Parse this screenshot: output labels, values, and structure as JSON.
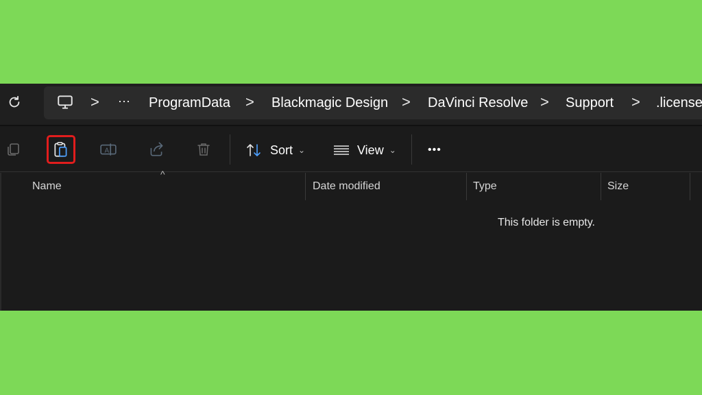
{
  "breadcrumb": {
    "overflow_label": "···",
    "items": [
      "ProgramData",
      "Blackmagic Design",
      "DaVinci Resolve",
      "Support",
      ".license"
    ],
    "separator": ">"
  },
  "toolbar": {
    "sort_label": "Sort",
    "view_label": "View",
    "more_label": "•••",
    "icons": [
      "copy-icon",
      "paste-icon",
      "rename-icon",
      "share-icon",
      "delete-icon"
    ],
    "selected_icon": "paste-icon",
    "highlight_color": "#e11d1d"
  },
  "columns": [
    "Name",
    "Date modified",
    "Type",
    "Size"
  ],
  "empty_message": "This folder is empty.",
  "colors": {
    "background": "#7dd957",
    "window": "#1b1b1b",
    "accent": "#4ea1ff"
  }
}
